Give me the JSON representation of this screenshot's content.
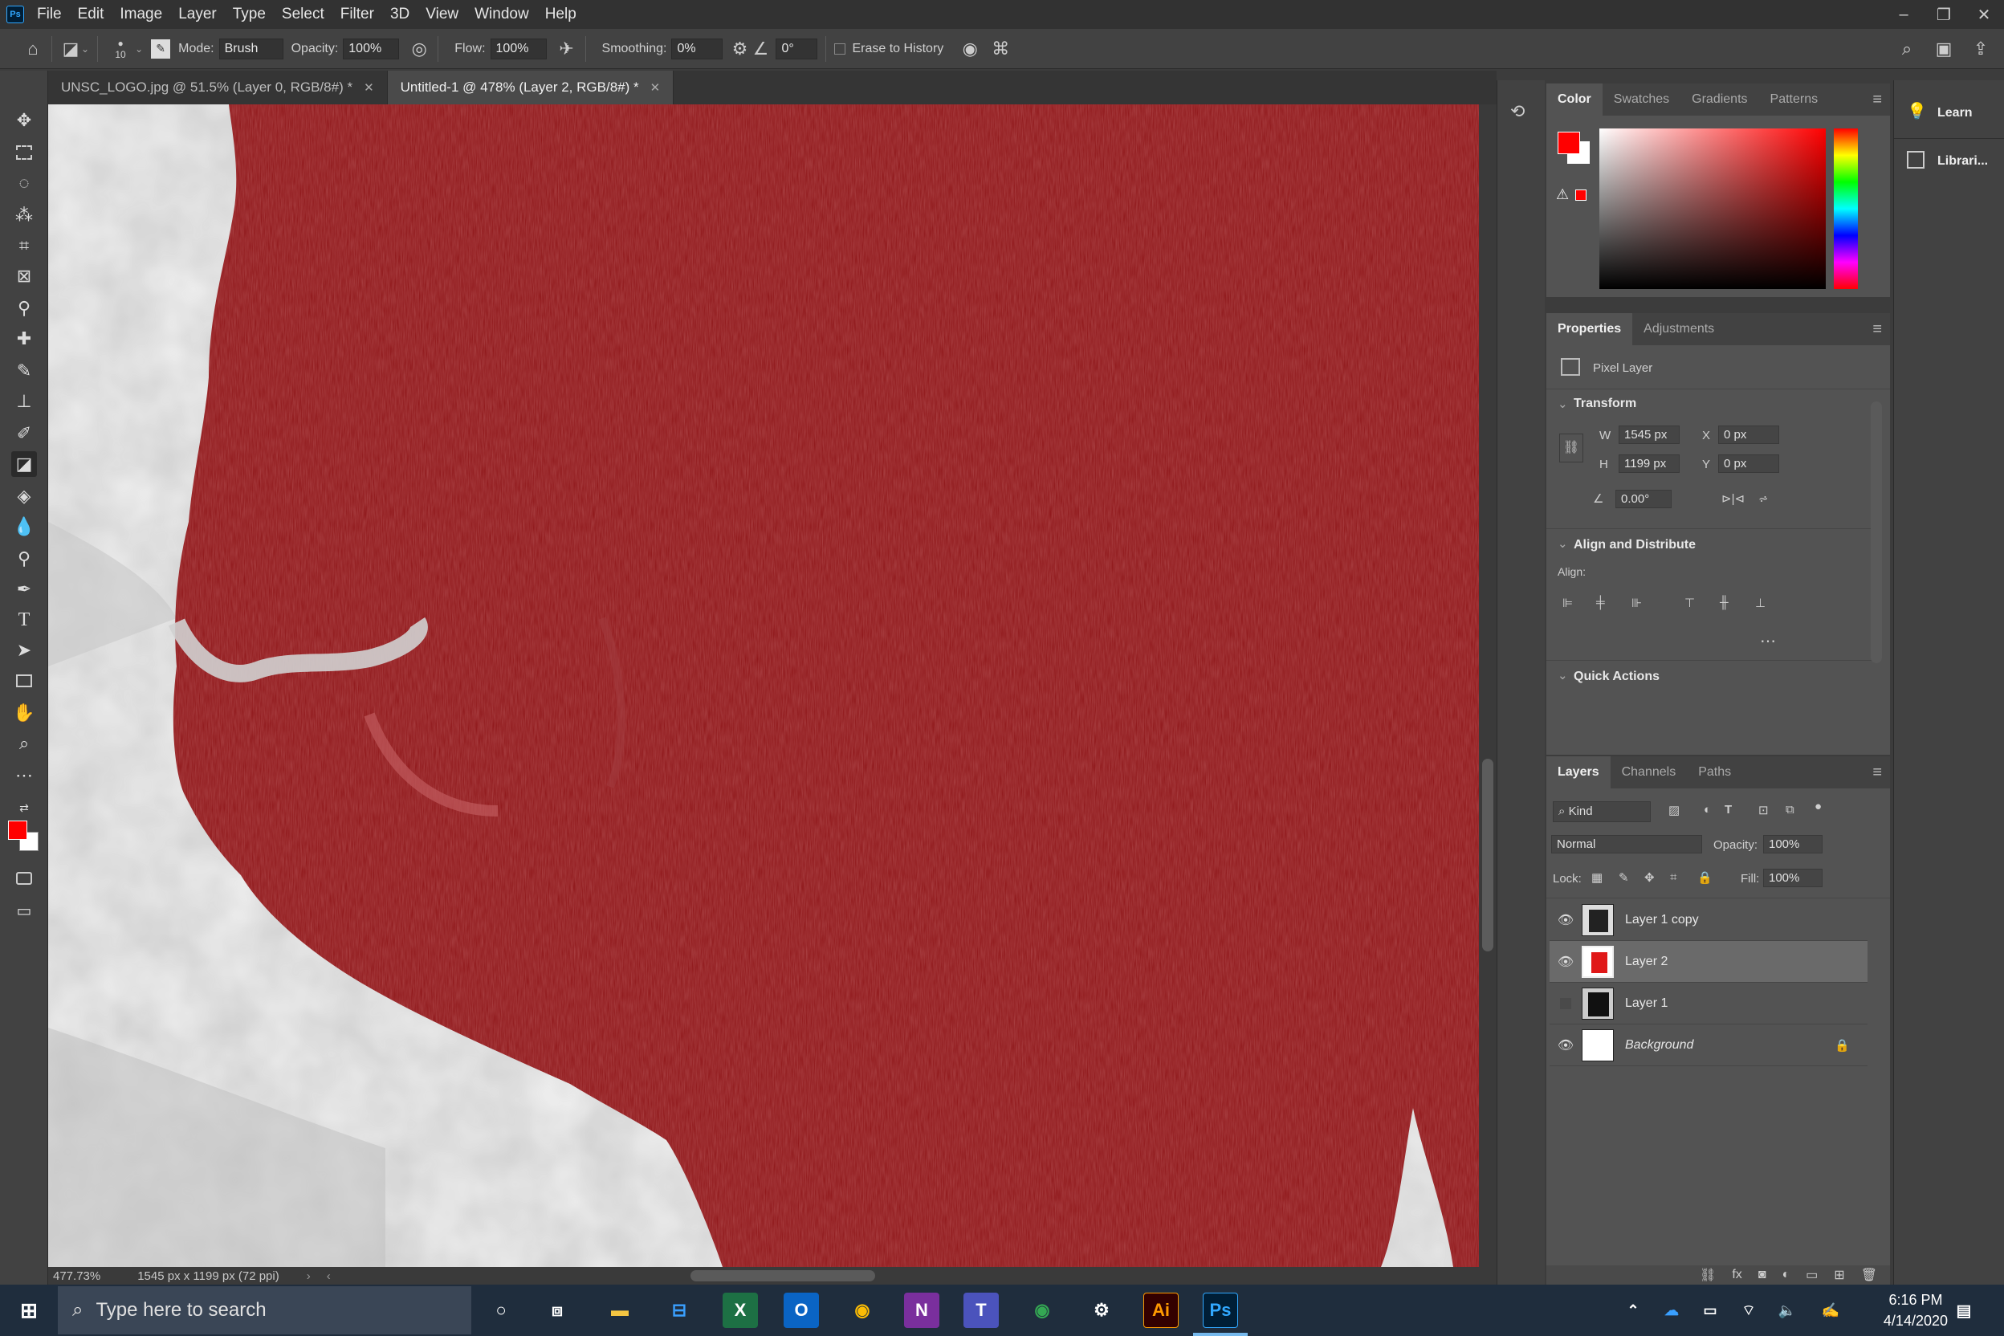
{
  "menubar": {
    "items": [
      "File",
      "Edit",
      "Image",
      "Layer",
      "Type",
      "Select",
      "Filter",
      "3D",
      "View",
      "Window",
      "Help"
    ]
  },
  "options": {
    "brush_size": "10",
    "mode_label": "Mode:",
    "mode_value": "Brush",
    "opacity_label": "Opacity:",
    "opacity_value": "100%",
    "flow_label": "Flow:",
    "flow_value": "100%",
    "smoothing_label": "Smoothing:",
    "smoothing_value": "0%",
    "angle_value": "0°",
    "erase_history_label": "Erase to History"
  },
  "tabs": [
    {
      "label": "UNSC_LOGO.jpg @ 51.5% (Layer 0, RGB/8#) *"
    },
    {
      "label": "Untitled-1 @ 478% (Layer 2, RGB/8#) *"
    }
  ],
  "status": {
    "zoom": "477.73%",
    "doc_info": "1545 px x 1199 px (72 ppi)"
  },
  "color_panel": {
    "tabs": [
      "Color",
      "Swatches",
      "Gradients",
      "Patterns"
    ],
    "foreground": "#ff0000",
    "background": "#ffffff"
  },
  "properties": {
    "tabs": [
      "Properties",
      "Adjustments"
    ],
    "type": "Pixel Layer",
    "transform_title": "Transform",
    "w_label": "W",
    "w": "1545 px",
    "h_label": "H",
    "h": "1199 px",
    "x_label": "X",
    "x": "0 px",
    "y_label": "Y",
    "y": "0 px",
    "angle": "0.00°",
    "align_title": "Align and Distribute",
    "align_label": "Align:",
    "quick_actions": "Quick Actions"
  },
  "layers_panel": {
    "tabs": [
      "Layers",
      "Channels",
      "Paths"
    ],
    "kind": "Kind",
    "blend": "Normal",
    "opacity_label": "Opacity:",
    "opacity": "100%",
    "lock_label": "Lock:",
    "fill_label": "Fill:",
    "fill": "100%",
    "layers": [
      {
        "name": "Layer 1 copy",
        "visible": true
      },
      {
        "name": "Layer 2",
        "visible": true,
        "selected": true
      },
      {
        "name": "Layer 1",
        "visible": false
      },
      {
        "name": "Background",
        "visible": true,
        "locked": true
      }
    ]
  },
  "dock": {
    "learn": "Learn",
    "libraries": "Librari..."
  },
  "taskbar": {
    "search_placeholder": "Type here to search",
    "time": "6:16 PM",
    "date": "4/14/2020"
  }
}
